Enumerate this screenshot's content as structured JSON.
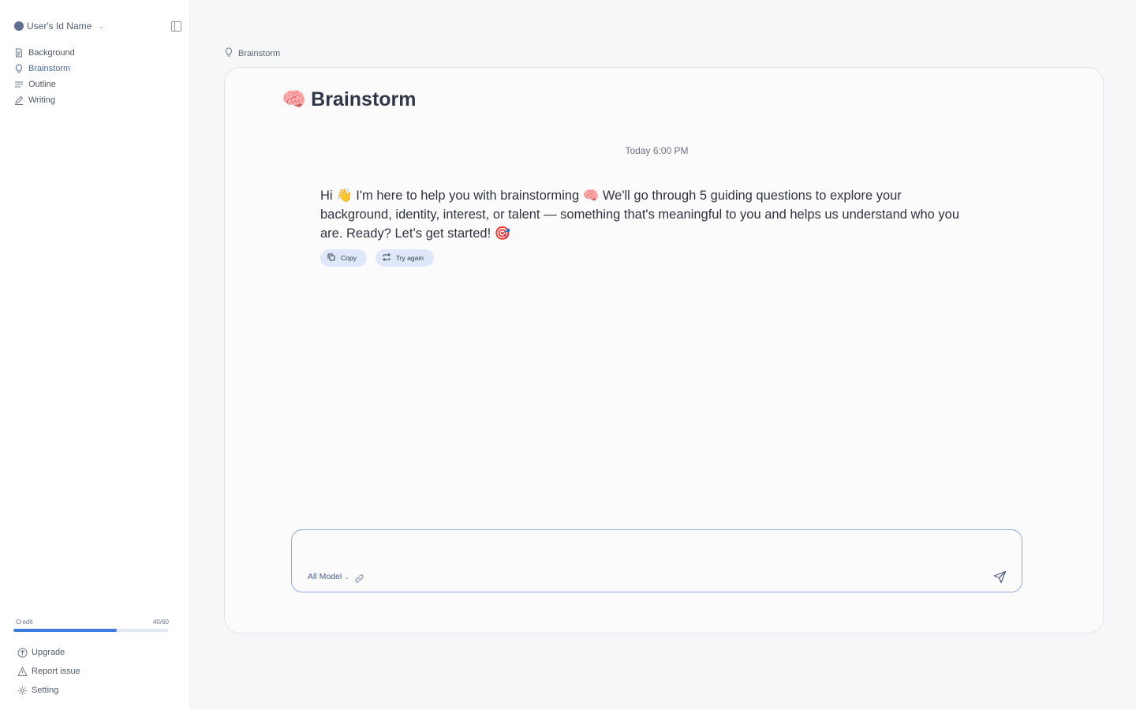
{
  "sidebar": {
    "user_name": "User's Id Name",
    "nav": [
      {
        "label": "Background",
        "icon": "document-icon",
        "active": false
      },
      {
        "label": "Brainstorm",
        "icon": "lightbulb-icon",
        "active": true
      },
      {
        "label": "Outline",
        "icon": "lines-icon",
        "active": false
      },
      {
        "label": "Writing",
        "icon": "pencil-icon",
        "active": false
      }
    ],
    "credit": {
      "label": "Credit",
      "value_text": "40/60",
      "used": 40,
      "total": 60
    },
    "bottom": [
      {
        "label": "Upgrade",
        "icon": "upgrade-icon"
      },
      {
        "label": "Report issue",
        "icon": "warning-icon"
      },
      {
        "label": "Setting",
        "icon": "gear-icon"
      }
    ]
  },
  "breadcrumb": {
    "label": "Brainstorm"
  },
  "page": {
    "title": "Brainstorm",
    "title_emoji": "🧠"
  },
  "chat": {
    "timestamp": "Today 6:00 PM",
    "message": "Hi 👋 I'm here to help you with brainstorming 🧠  We'll go through 5 guiding questions to explore your background, identity, interest, or talent — something that's meaningful to you and helps us understand who you are. Ready? Let’s get started! 🎯",
    "actions": {
      "copy": "Copy",
      "retry": "Try again"
    }
  },
  "composer": {
    "value": "",
    "model_label": "All Model"
  },
  "colors": {
    "accent": "#3d7bdf",
    "active_nav": "#4c6aa0",
    "chip_bg": "#dfe8f8",
    "composer_border": "#8fa8e0"
  }
}
